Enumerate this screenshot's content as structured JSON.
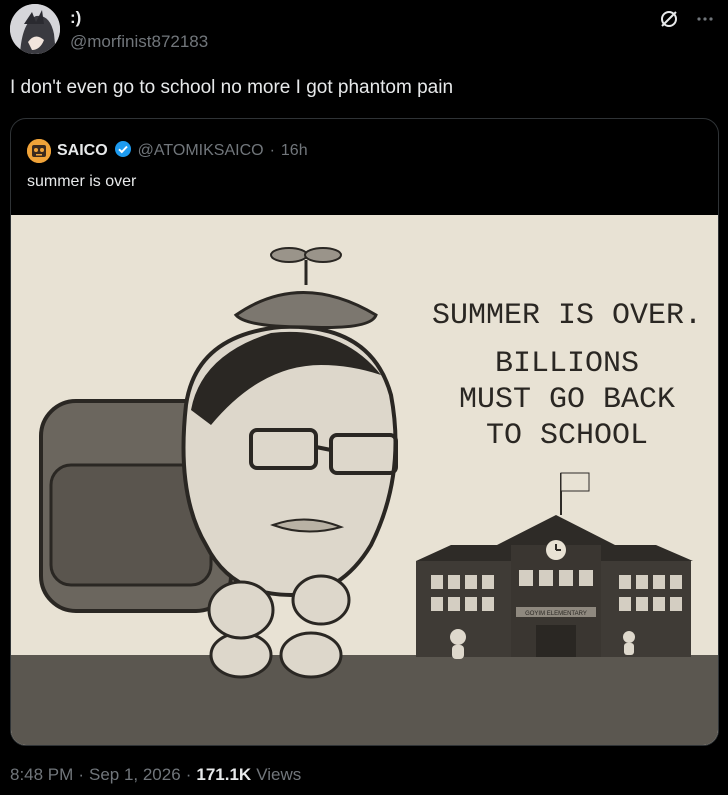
{
  "post": {
    "display_name": ":)",
    "handle": "@morfinist872183",
    "text": "I don't even go to school no more I got phantom pain"
  },
  "quote": {
    "display_name": "SAICO",
    "handle": "@ATOMIKSAICO",
    "separator": "·",
    "time": "16h",
    "text": "summer is over",
    "image_text": {
      "line1": "SUMMER IS OVER.",
      "line2": "BILLIONS",
      "line3": "MUST GO BACK",
      "line4": "TO SCHOOL",
      "sign": "GOYIM ELEMENTARY"
    }
  },
  "meta": {
    "time": "8:48 PM",
    "dot1": "·",
    "date": "Sep 1, 2026",
    "dot2": "·",
    "views_count": "171.1K",
    "views_label": "Views"
  },
  "icons": {
    "grok": "grok-icon",
    "more": "more-icon",
    "verified": "verified-badge-icon"
  },
  "colors": {
    "background": "#000000",
    "text": "#e7e9ea",
    "secondary": "#71767b",
    "border": "#2f3336",
    "verified": "#1d9bf0"
  }
}
